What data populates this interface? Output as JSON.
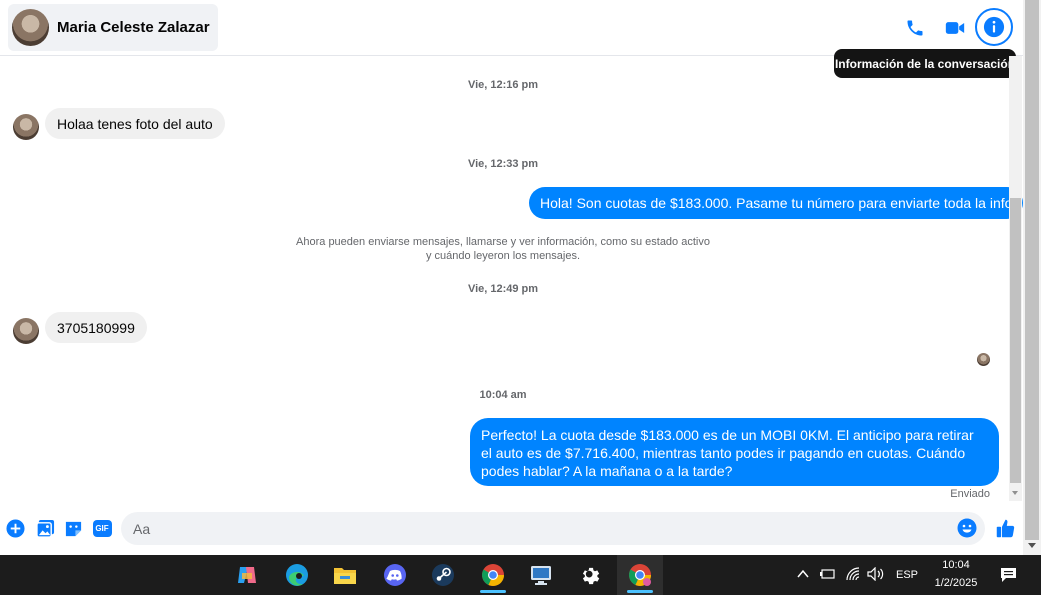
{
  "header": {
    "contact_name": "Maria Celeste Zalazar",
    "tooltip": "Información de la conversación",
    "icons": [
      "phone-icon",
      "video-icon",
      "info-icon"
    ]
  },
  "messages": {
    "ts1": "Vie, 12:16 pm",
    "in1": "Holaa tenes foto del auto",
    "ts2": "Vie, 12:33 pm",
    "out1": "Hola! Son cuotas de $183.000. Pasame tu número para enviarte toda la info",
    "system_line1": "Ahora pueden enviarse mensajes, llamarse y ver información, como su estado activo",
    "system_line2": "y cuándo leyeron los mensajes.",
    "ts3": "Vie, 12:49 pm",
    "in2": "3705180999",
    "ts4": "10:04 am",
    "out2": "Perfecto! La cuota desde $183.000 es de un MOBI 0KM. El anticipo para retirar el auto es de $7.716.400, mientras tanto podes ir pagando en cuotas. Cuándo podes hablar? A la mañana o a la tarde?",
    "status": "Enviado"
  },
  "composer": {
    "placeholder": "Aa",
    "gif_label": "GIF"
  },
  "colors": {
    "accent": "#0084ff",
    "icon": "#0a7cff"
  },
  "taskbar": {
    "apps": [
      "copilot-icon",
      "edge-icon",
      "file-explorer-icon",
      "discord-icon",
      "steam-icon",
      "chrome-icon",
      "remote-desktop-icon",
      "settings-icon",
      "chrome-profile-icon"
    ],
    "language": "ESP",
    "time": "10:04",
    "date": "1/2/2025"
  }
}
